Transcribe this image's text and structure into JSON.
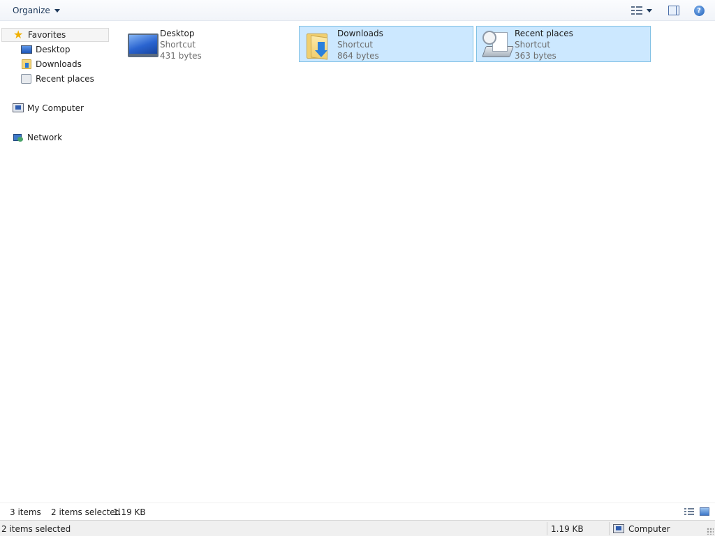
{
  "toolbar": {
    "organize_label": "Organize"
  },
  "nav": {
    "favorites": {
      "label": "Favorites",
      "icon": "star-icon"
    },
    "favorite_items": [
      {
        "label": "Desktop",
        "icon": "desktop-icon"
      },
      {
        "label": "Downloads",
        "icon": "downloads-folder-icon"
      },
      {
        "label": "Recent places",
        "icon": "recent-places-icon"
      }
    ],
    "computer": {
      "label": "My Computer",
      "icon": "computer-icon"
    },
    "network": {
      "label": "Network",
      "icon": "network-icon"
    }
  },
  "items": [
    {
      "name": "Desktop",
      "type": "Shortcut",
      "size": "431 bytes",
      "selected": false,
      "icon": "desktop-icon"
    },
    {
      "name": "Downloads",
      "type": "Shortcut",
      "size": "864 bytes",
      "selected": true,
      "icon": "downloads-folder-icon"
    },
    {
      "name": "Recent places",
      "type": "Shortcut",
      "size": "363 bytes",
      "selected": true,
      "icon": "recent-places-icon"
    }
  ],
  "details": {
    "item_count": "3 items",
    "selected_count": "2 items selected",
    "selected_size": "1.19 KB"
  },
  "status": {
    "selection": "2 items selected",
    "size": "1.19 KB",
    "location": "Computer"
  },
  "colors": {
    "selection_fill": "#cce8ff",
    "selection_border": "#7fc0e4",
    "toolbar_text": "#1e395b"
  }
}
